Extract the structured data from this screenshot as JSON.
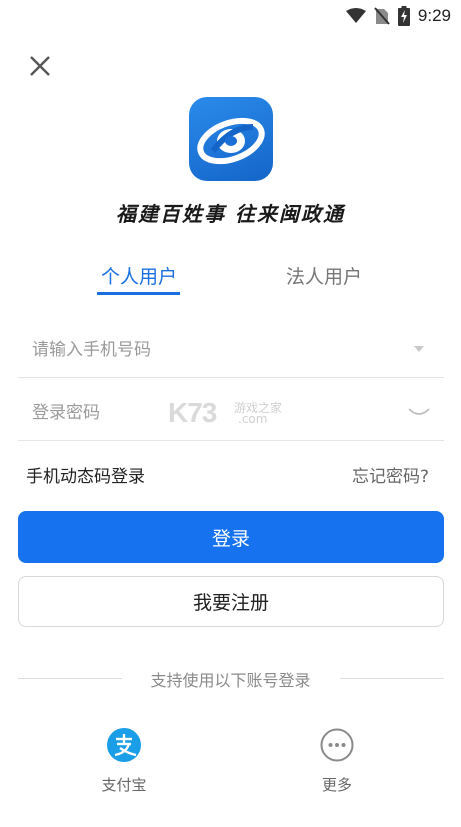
{
  "status_bar": {
    "time": "9:29"
  },
  "slogan": "福建百姓事 往来闽政通",
  "tabs": [
    {
      "label": "个人用户",
      "active": true
    },
    {
      "label": "法人用户",
      "active": false
    }
  ],
  "form": {
    "phone_placeholder": "请输入手机号码",
    "password_placeholder": "登录密码"
  },
  "links": {
    "sms_login": "手机动态码登录",
    "forgot_password": "忘记密码?"
  },
  "buttons": {
    "login": "登录",
    "register": "我要注册"
  },
  "third_party": {
    "divider_text": "支持使用以下账号登录",
    "items": [
      {
        "label": "支付宝",
        "icon": "alipay-icon"
      },
      {
        "label": "更多",
        "icon": "more-icon"
      }
    ]
  },
  "watermark": {
    "brand": "K73",
    "cn": "游戏之家",
    "domain": ".com"
  },
  "colors": {
    "primary": "#1672ef",
    "tab_active": "#1a6fe0",
    "alipay": "#1a9ee8"
  }
}
